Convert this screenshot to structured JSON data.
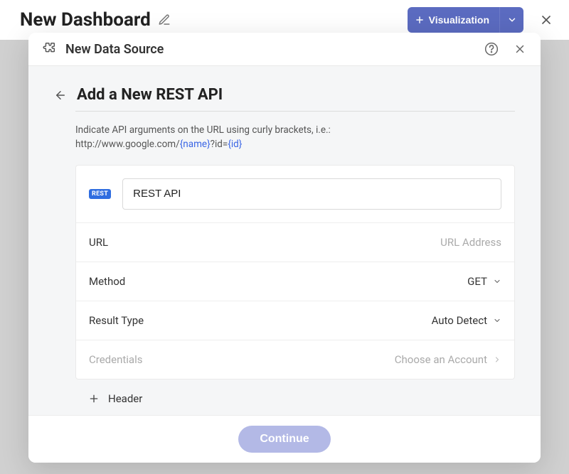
{
  "page": {
    "title": "New Dashboard"
  },
  "header": {
    "visualization_label": "Visualization"
  },
  "modal": {
    "title": "New Data Source",
    "form_title": "Add a New REST API",
    "help_text_pre": "Indicate API arguments on the URL using curly brackets, i.e.:",
    "help_text_url_pre": "http://www.google.com/",
    "help_text_arg1": "{name}",
    "help_text_mid": "?id=",
    "help_text_arg2": "{id}",
    "rest_badge": "REST",
    "name_value": "REST API",
    "fields": {
      "url": {
        "label": "URL",
        "placeholder": "URL Address"
      },
      "method": {
        "label": "Method",
        "value": "GET"
      },
      "result_type": {
        "label": "Result Type",
        "value": "Auto Detect"
      },
      "credentials": {
        "label": "Credentials",
        "placeholder": "Choose an Account"
      }
    },
    "add_header_label": "Header",
    "footer": {
      "continue": "Continue"
    }
  }
}
